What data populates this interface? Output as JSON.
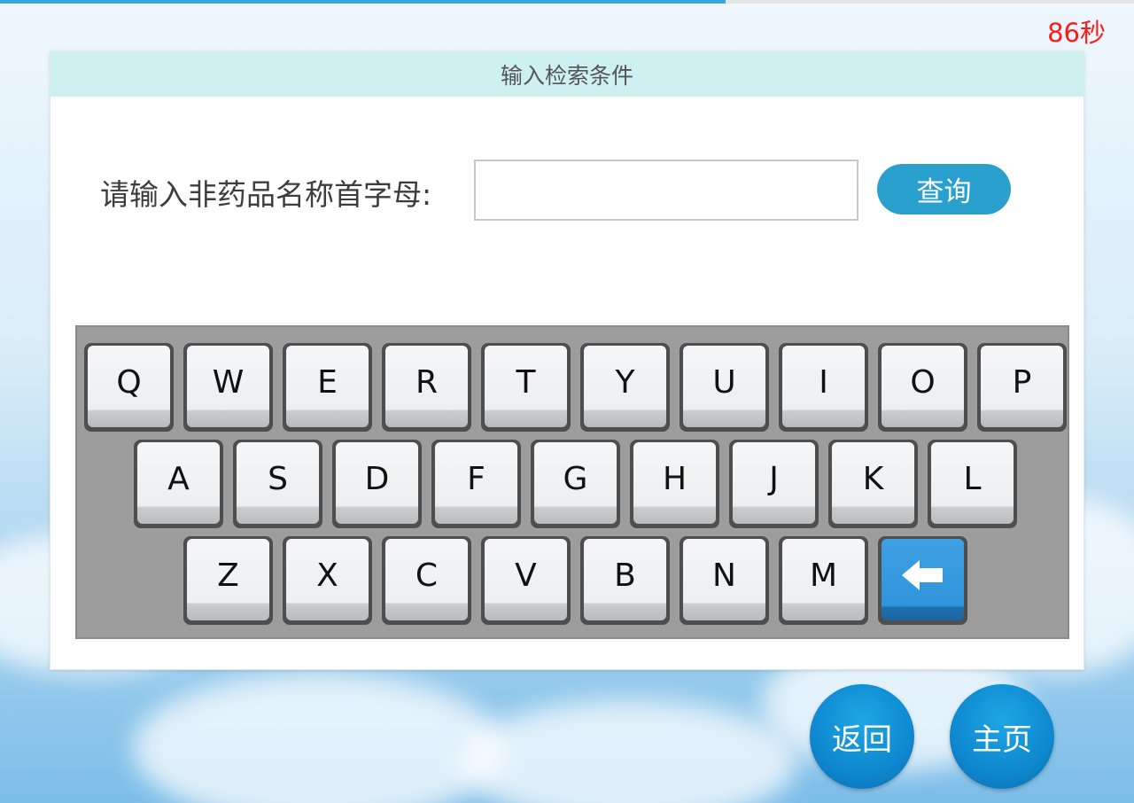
{
  "progress": {
    "fraction": 0.64
  },
  "countdown": "86秒",
  "panel": {
    "title": "输入检索条件"
  },
  "search": {
    "label": "请输入非药品名称首字母:",
    "value": "",
    "button_label": "查询"
  },
  "keyboard": {
    "rows": [
      [
        "Q",
        "W",
        "E",
        "R",
        "T",
        "Y",
        "U",
        "I",
        "O",
        "P"
      ],
      [
        "A",
        "S",
        "D",
        "F",
        "G",
        "H",
        "J",
        "K",
        "L"
      ],
      [
        "Z",
        "X",
        "C",
        "V",
        "B",
        "N",
        "M"
      ]
    ],
    "backspace_icon": "left-arrow-icon"
  },
  "nav": {
    "back_label": "返回",
    "home_label": "主页"
  },
  "colors": {
    "accent": "#2aa0cf",
    "countdown": "#ff1a1a",
    "header_bg": "#cdf1ef",
    "backspace_key": "#2f95db"
  }
}
